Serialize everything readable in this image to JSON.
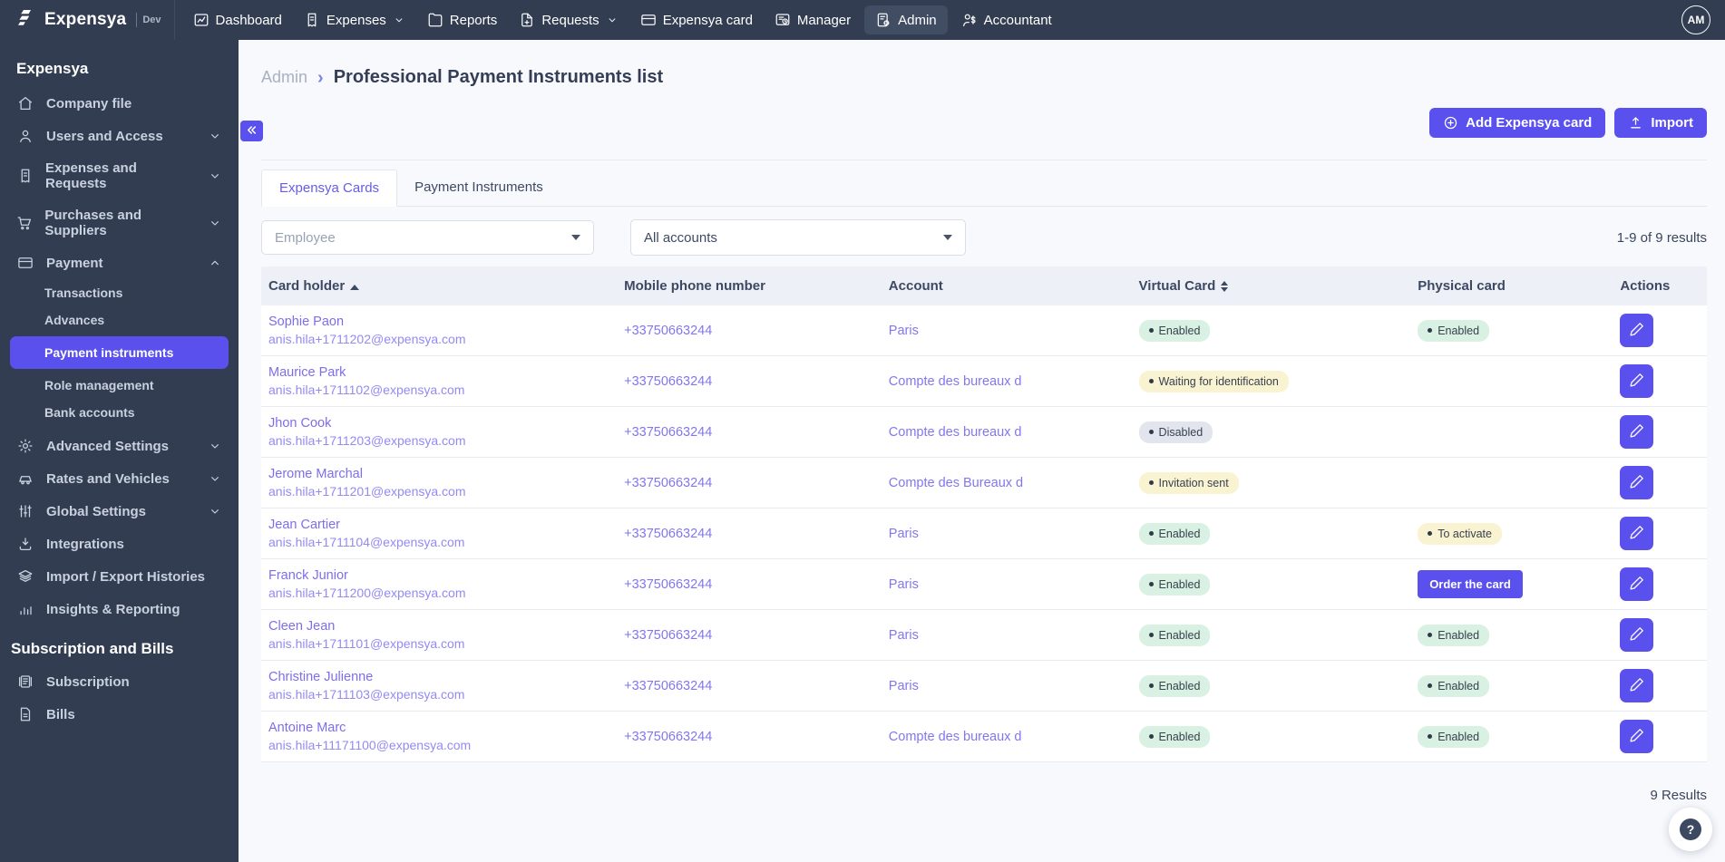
{
  "colors": {
    "accent": "#5A50EE",
    "dark": "#323D51",
    "link": "#8276F0",
    "pill_green": "#D9F1E2",
    "pill_yellow": "#FAF3D1",
    "pill_gray": "#E2E5EE"
  },
  "topbar": {
    "brand": "Expensya",
    "env": "Dev",
    "avatar": "AM",
    "items": [
      {
        "label": "Dashboard",
        "icon": "dashboard-icon"
      },
      {
        "label": "Expenses",
        "icon": "expenses-icon",
        "chevron": true
      },
      {
        "label": "Reports",
        "icon": "reports-icon"
      },
      {
        "label": "Requests",
        "icon": "requests-icon",
        "chevron": true
      },
      {
        "label": "Expensya card",
        "icon": "expensya-card-icon"
      },
      {
        "label": "Manager",
        "icon": "manager-icon"
      },
      {
        "label": "Admin",
        "icon": "admin-icon",
        "active": true
      },
      {
        "label": "Accountant",
        "icon": "accountant-icon"
      }
    ]
  },
  "sidebar": {
    "title": "Expensya",
    "items": [
      {
        "label": "Company file",
        "icon": "home-icon"
      },
      {
        "label": "Users and Access",
        "icon": "users-icon",
        "chevron": "down"
      },
      {
        "label": "Expenses and Requests",
        "icon": "receipt-icon",
        "chevron": "down"
      },
      {
        "label": "Purchases and Suppliers",
        "icon": "cart-icon",
        "chevron": "down"
      },
      {
        "label": "Payment",
        "icon": "credit-card-icon",
        "chevron": "up",
        "expanded": true,
        "children": [
          {
            "label": "Transactions"
          },
          {
            "label": "Advances"
          },
          {
            "label": "Payment instruments",
            "active": true
          },
          {
            "label": "Role management"
          },
          {
            "label": "Bank accounts"
          }
        ]
      },
      {
        "label": "Advanced Settings",
        "icon": "gear-icon",
        "chevron": "down"
      },
      {
        "label": "Rates and Vehicles",
        "icon": "car-icon",
        "chevron": "down"
      },
      {
        "label": "Global Settings",
        "icon": "sliders-icon",
        "chevron": "down"
      },
      {
        "label": "Integrations",
        "icon": "download-icon"
      },
      {
        "label": "Import / Export Histories",
        "icon": "layers-icon"
      },
      {
        "label": "Insights & Reporting",
        "icon": "bar-chart-icon"
      }
    ],
    "section_title": "Subscription and Bills",
    "section_items": [
      {
        "label": "Subscription",
        "icon": "newspaper-icon"
      },
      {
        "label": "Bills",
        "icon": "bill-icon"
      }
    ]
  },
  "header": {
    "breadcrumb": "Admin",
    "title": "Professional Payment Instruments list"
  },
  "toolbar": {
    "add_card_label": "Add Expensya card",
    "import_label": "Import"
  },
  "tabs": [
    {
      "label": "Expensya Cards",
      "active": true
    },
    {
      "label": "Payment Instruments",
      "active": false
    }
  ],
  "filters": {
    "employee_placeholder": "Employee",
    "accounts_value": "All accounts",
    "results_summary": "1-9 of 9 results"
  },
  "table": {
    "columns": [
      {
        "label": "Card holder",
        "sort": "asc"
      },
      {
        "label": "Mobile phone number"
      },
      {
        "label": "Account"
      },
      {
        "label": "Virtual Card",
        "sort": "both"
      },
      {
        "label": "Physical card"
      },
      {
        "label": "Actions"
      }
    ],
    "rows": [
      {
        "name": "Sophie Paon",
        "email": "anis.hila+1711202@expensya.com",
        "phone": "+33750663244",
        "account": "Paris",
        "virtual": {
          "label": "Enabled",
          "type": "green"
        },
        "physical": {
          "label": "Enabled",
          "type": "green"
        }
      },
      {
        "name": "Maurice Park",
        "email": "anis.hila+1711102@expensya.com",
        "phone": "+33750663244",
        "account": "Compte des bureaux d",
        "virtual": {
          "label": "Waiting for identification",
          "type": "yellow"
        }
      },
      {
        "name": "Jhon Cook",
        "email": "anis.hila+1711203@expensya.com",
        "phone": "+33750663244",
        "account": "Compte des bureaux d",
        "virtual": {
          "label": "Disabled",
          "type": "gray"
        }
      },
      {
        "name": "Jerome Marchal",
        "email": "anis.hila+1711201@expensya.com",
        "phone": "+33750663244",
        "account": "Compte des Bureaux d",
        "virtual": {
          "label": "Invitation sent",
          "type": "yellow"
        }
      },
      {
        "name": "Jean Cartier",
        "email": "anis.hila+1711104@expensya.com",
        "phone": "+33750663244",
        "account": "Paris",
        "virtual": {
          "label": "Enabled",
          "type": "green"
        },
        "physical": {
          "label": "To activate",
          "type": "yellow"
        }
      },
      {
        "name": "Franck Junior",
        "email": "anis.hila+1711200@expensya.com",
        "phone": "+33750663244",
        "account": "Paris",
        "virtual": {
          "label": "Enabled",
          "type": "green"
        },
        "physical_button": "Order the card"
      },
      {
        "name": "Cleen Jean",
        "email": "anis.hila+1711101@expensya.com",
        "phone": "+33750663244",
        "account": "Paris",
        "virtual": {
          "label": "Enabled",
          "type": "green"
        },
        "physical": {
          "label": "Enabled",
          "type": "green"
        }
      },
      {
        "name": "Christine Julienne",
        "email": "anis.hila+1711103@expensya.com",
        "phone": "+33750663244",
        "account": "Paris",
        "virtual": {
          "label": "Enabled",
          "type": "green"
        },
        "physical": {
          "label": "Enabled",
          "type": "green"
        }
      },
      {
        "name": "Antoine Marc",
        "email": "anis.hila+11171100@expensya.com",
        "phone": "+33750663244",
        "account": "Compte des bureaux d",
        "virtual": {
          "label": "Enabled",
          "type": "green"
        },
        "physical": {
          "label": "Enabled",
          "type": "green"
        }
      }
    ]
  },
  "footer": {
    "results": "9 Results",
    "help_label": "?"
  }
}
